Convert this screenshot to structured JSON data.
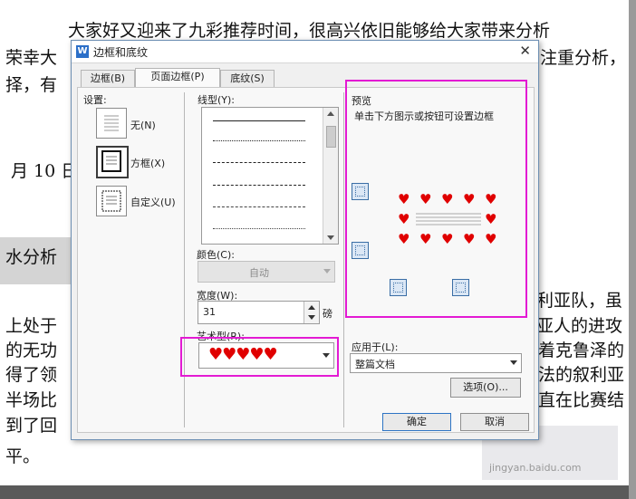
{
  "document": {
    "lines": [
      {
        "id": "l1",
        "text": "大家好又迎来了九彩推荐时间，很高兴依旧能够给大家带来分析"
      },
      {
        "id": "l2a",
        "text": "荣幸大"
      },
      {
        "id": "l2b",
        "text": "注重分析，"
      },
      {
        "id": "l3",
        "text": "择，有"
      },
      {
        "id": "l4",
        "text": "月 10 日"
      },
      {
        "id": "l5",
        "text": "水分析"
      },
      {
        "id": "l6a",
        "text": "上处于"
      },
      {
        "id": "l6b",
        "text": "利亚队，虽"
      },
      {
        "id": "l7a",
        "text": "的无功"
      },
      {
        "id": "l7b",
        "text": "亚人的进攻"
      },
      {
        "id": "l8a",
        "text": "得了领"
      },
      {
        "id": "l8b",
        "text": "着克鲁泽的"
      },
      {
        "id": "l9a",
        "text": "半场比"
      },
      {
        "id": "l9b",
        "text": "法的叙利亚"
      },
      {
        "id": "l10a",
        "text": "到了回"
      },
      {
        "id": "l10b",
        "text": "直在比赛结"
      },
      {
        "id": "l11",
        "text": "平。"
      }
    ],
    "watermark": "jingyan.baidu.com"
  },
  "dialog": {
    "title": "边框和底纹",
    "app_icon": "W",
    "close_glyph": "✕",
    "tabs": [
      "边框(B)",
      "页面边框(P)",
      "底纹(S)"
    ],
    "active_tab": 1,
    "settings": {
      "label": "设置:",
      "options": [
        "无(N)",
        "方框(X)",
        "自定义(U)"
      ],
      "selected": 1
    },
    "line_style": {
      "label": "线型(Y):"
    },
    "color": {
      "label": "颜色(C):",
      "value": "自动"
    },
    "width": {
      "label": "宽度(W):",
      "value": "31",
      "unit": "磅"
    },
    "art": {
      "label": "艺术型(R):",
      "value": "♥♥♥♥♥"
    },
    "preview": {
      "label": "预览",
      "hint": "单击下方图示或按钮可设置边框"
    },
    "apply_to": {
      "label": "应用于(L):",
      "value": "整篇文档"
    },
    "options_button": "选项(O)...",
    "ok_button": "确定",
    "cancel_button": "取消"
  },
  "colors": {
    "highlight": "#e31ad3",
    "heart": "#e00000",
    "accent": "#2d74c4"
  }
}
